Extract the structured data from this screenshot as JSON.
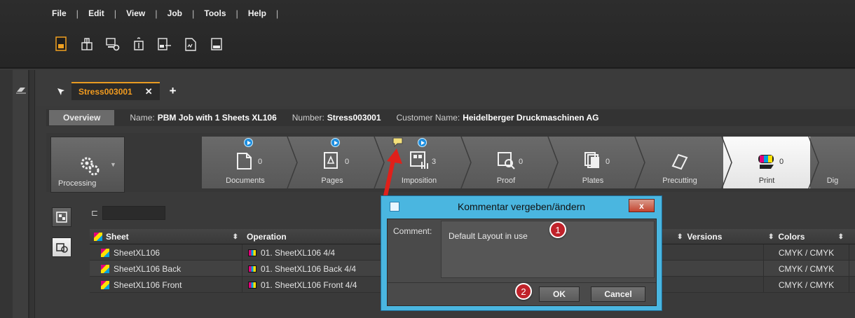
{
  "menu": [
    "File",
    "Edit",
    "View",
    "Job",
    "Tools",
    "Help"
  ],
  "toolbar_icons": [
    "new-job-icon",
    "hierarchy-icon",
    "computer-settings-icon",
    "transfer-icon",
    "import-layout-icon",
    "signature-icon",
    "output-icon"
  ],
  "job_tab": {
    "title": "Stress003001",
    "close": "✕",
    "add": "+"
  },
  "info": {
    "overview": "Overview",
    "name_label": "Name:",
    "name_value": "PBM Job with 1 Sheets XL106",
    "number_label": "Number:",
    "number_value": "Stress003001",
    "customer_label": "Customer Name:",
    "customer_value": "Heidelberger Druckmaschinen AG"
  },
  "processing": {
    "label": "Processing"
  },
  "steps": [
    {
      "label": "Documents",
      "count": "0",
      "play": true
    },
    {
      "label": "Pages",
      "count": "0",
      "play": true
    },
    {
      "label": "Imposition",
      "count": "3",
      "play": true
    },
    {
      "label": "Proof",
      "count": "0",
      "play": false
    },
    {
      "label": "Plates",
      "count": "0",
      "play": false
    },
    {
      "label": "Precutting",
      "count": "",
      "play": false
    },
    {
      "label": "Print",
      "count": "0",
      "play": false,
      "active": true
    },
    {
      "label": "Dig",
      "count": "",
      "play": false
    }
  ],
  "table": {
    "headers": {
      "sheet": "Sheet",
      "operation": "Operation",
      "versions": "Versions",
      "colors": "Colors"
    },
    "rows": [
      {
        "sheet": "SheetXL106",
        "operation": "01. SheetXL106 4/4",
        "colors": "CMYK / CMYK"
      },
      {
        "sheet": "SheetXL106 Back",
        "operation": "01. SheetXL106 Back 4/4",
        "colors": "CMYK / CMYK"
      },
      {
        "sheet": "SheetXL106 Front",
        "operation": "01. SheetXL106 Front 4/4",
        "colors": "CMYK / CMYK"
      }
    ]
  },
  "dialog": {
    "title": "Kommentar vergeben/ändern",
    "close": "x",
    "comment_label": "Comment:",
    "comment_value": "Default Layout in use",
    "ok": "OK",
    "cancel": "Cancel",
    "badge_1": "1",
    "badge_2": "2"
  },
  "colors": {
    "accent": "#f39c1f",
    "dialog": "#4ab6e0",
    "badge": "#c0222a",
    "arrow": "#e0201a"
  }
}
